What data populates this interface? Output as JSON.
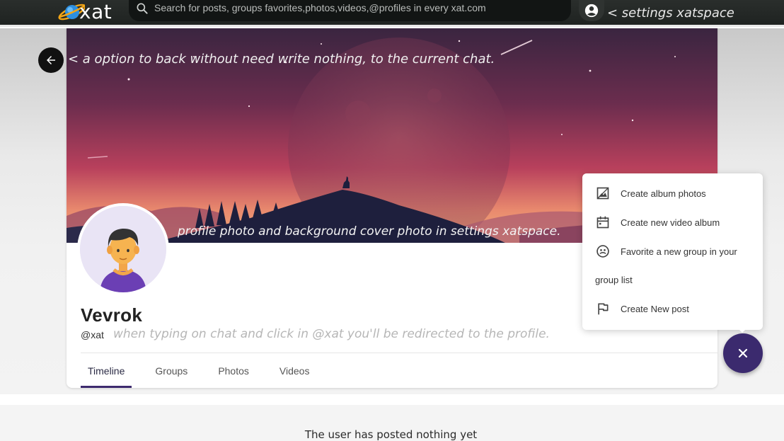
{
  "app": {
    "logo_text": "xat"
  },
  "search": {
    "placeholder": "Search for posts, groups favorites,photos,videos,@profiles in every xat.com"
  },
  "annotations": {
    "settings": "< settings xatspace",
    "back": "< a option to back without need write nothing, to the current chat.",
    "cover": "profile photo and background cover photo in settings xatspace.",
    "redirect": "when typing on chat and click in @xat you'll be redirected to the profile."
  },
  "profile": {
    "name": "Vevrok",
    "handle": "@xat"
  },
  "tabs": [
    {
      "label": "Timeline",
      "active": true
    },
    {
      "label": "Groups",
      "active": false
    },
    {
      "label": "Photos",
      "active": false
    },
    {
      "label": "Videos",
      "active": false
    }
  ],
  "menu": {
    "items": [
      {
        "label": "Create album photos",
        "icon": "image-icon"
      },
      {
        "label": "Create new video album",
        "icon": "calendar-icon"
      },
      {
        "label": "Favorite a new group in your",
        "icon": "group-icon"
      },
      {
        "label": "Create New post",
        "icon": "flag-icon"
      }
    ],
    "continuation": "group list"
  },
  "posts": {
    "empty_message": "The user has posted nothing yet"
  },
  "colors": {
    "accent": "#3b2a6e",
    "topbar": "#222624",
    "cover_top": "#3a2540",
    "cover_mid": "#b8405c"
  }
}
